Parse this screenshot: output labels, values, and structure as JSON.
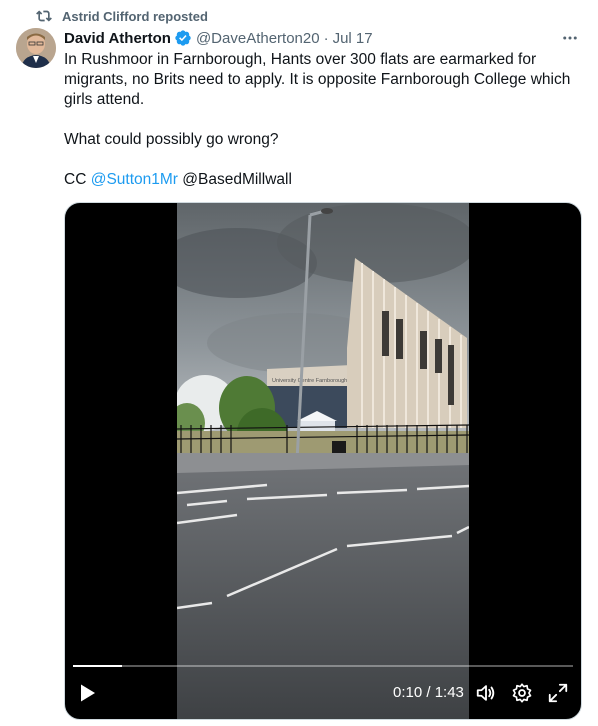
{
  "repost": {
    "label": "Astrid Clifford reposted",
    "icon": "repost-icon"
  },
  "author": {
    "name": "David Atherton",
    "handle": "@DaveAtherton20",
    "date": "Jul 17",
    "verified": true
  },
  "tweet": {
    "line1": "In Rushmoor in Farnborough, Hants over 300 flats are earmarked for migrants, no Brits need to apply. It is opposite Farnborough College which girls attend.",
    "line2": "What could possibly go wrong?",
    "cc_prefix": "CC ",
    "mention1": "@Sutton1Mr",
    "mention2": "@BasedMillwall"
  },
  "video": {
    "time": "0:10 / 1:43",
    "progress": 0.097,
    "building_sign": "University Centre Farnborough"
  },
  "colors": {
    "accent": "#1d9bf0",
    "muted": "#536471",
    "text": "#0f1419"
  }
}
